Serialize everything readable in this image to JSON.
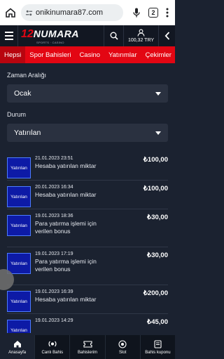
{
  "browser": {
    "url": "onikinumara87.com",
    "tab_count": "2"
  },
  "header": {
    "logo_number": "12",
    "logo_word": "NUMARA",
    "logo_tagline": "SPORTS · CASINO",
    "balance": "100,32 TRY"
  },
  "categories": [
    "Hepsi",
    "Spor Bahisleri",
    "Casino",
    "Yatırımlar",
    "Çekimler"
  ],
  "filters": {
    "date_range_label": "Zaman Aralığı",
    "date_range_value": "Ocak",
    "status_label": "Durum",
    "status_value": "Yatırılan"
  },
  "transactions": [
    {
      "thumb": "Yatırılan",
      "date": "21.01.2023 23:51",
      "desc": "Hesaba yatırılan miktar",
      "amount": "₺100,00"
    },
    {
      "thumb": "Yatırılan",
      "date": "20.01.2023 16:34",
      "desc": "Hesaba yatırılan miktar",
      "amount": "₺100,00"
    },
    {
      "thumb": "Yatırılan",
      "date": "19.01.2023 18:36",
      "desc": "Para yatırma işlemi için verilen bonus",
      "amount": "₺30,00"
    },
    {
      "thumb": "Yatırılan",
      "date": "19.01.2023 17:19",
      "desc": "Para yatırma işlemi için verilen bonus",
      "amount": "₺30,00"
    },
    {
      "thumb": "Yatırılan",
      "date": "19.01.2023 16:39",
      "desc": "Hesaba yatırılan miktar",
      "amount": "₺200,00"
    },
    {
      "thumb": "Yatırılan",
      "date": "19.01.2023 14:29",
      "desc": "",
      "amount": "₺45,00"
    }
  ],
  "bottom_nav": [
    {
      "label": "Anasayfa",
      "icon": "home-icon"
    },
    {
      "label": "Canlı Bahis",
      "icon": "live-icon"
    },
    {
      "label": "Bahislerim",
      "icon": "ticket-icon"
    },
    {
      "label": "Slot",
      "icon": "slot-icon"
    },
    {
      "label": "Bahis kuponu",
      "icon": "coupon-icon"
    }
  ],
  "colors": {
    "brand_red": "#e30613",
    "page_bg": "#1b2230",
    "thumb_blue": "#0d1aa6"
  }
}
